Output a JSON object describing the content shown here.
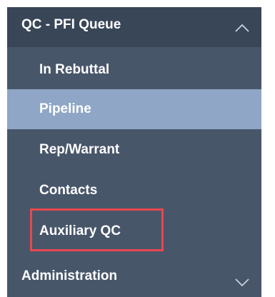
{
  "nav": {
    "section": {
      "label": "QC - PFI Queue",
      "expanded": true,
      "icon": "chevron-up-icon"
    },
    "items": [
      {
        "label": "In Rebuttal",
        "selected": false
      },
      {
        "label": "Pipeline",
        "selected": true
      },
      {
        "label": "Rep/Warrant",
        "selected": false
      },
      {
        "label": "Contacts",
        "selected": false
      },
      {
        "label": "Auxiliary QC",
        "selected": false,
        "highlighted": true
      }
    ],
    "next_section": {
      "label": "Administration",
      "expanded": false,
      "icon": "chevron-down-icon"
    }
  },
  "colors": {
    "sidebar_bg": "#48566a",
    "header_bg": "#394658",
    "selected_bg": "#8fa6c6",
    "highlight_border": "#e8474e",
    "text": "#ffffff"
  }
}
